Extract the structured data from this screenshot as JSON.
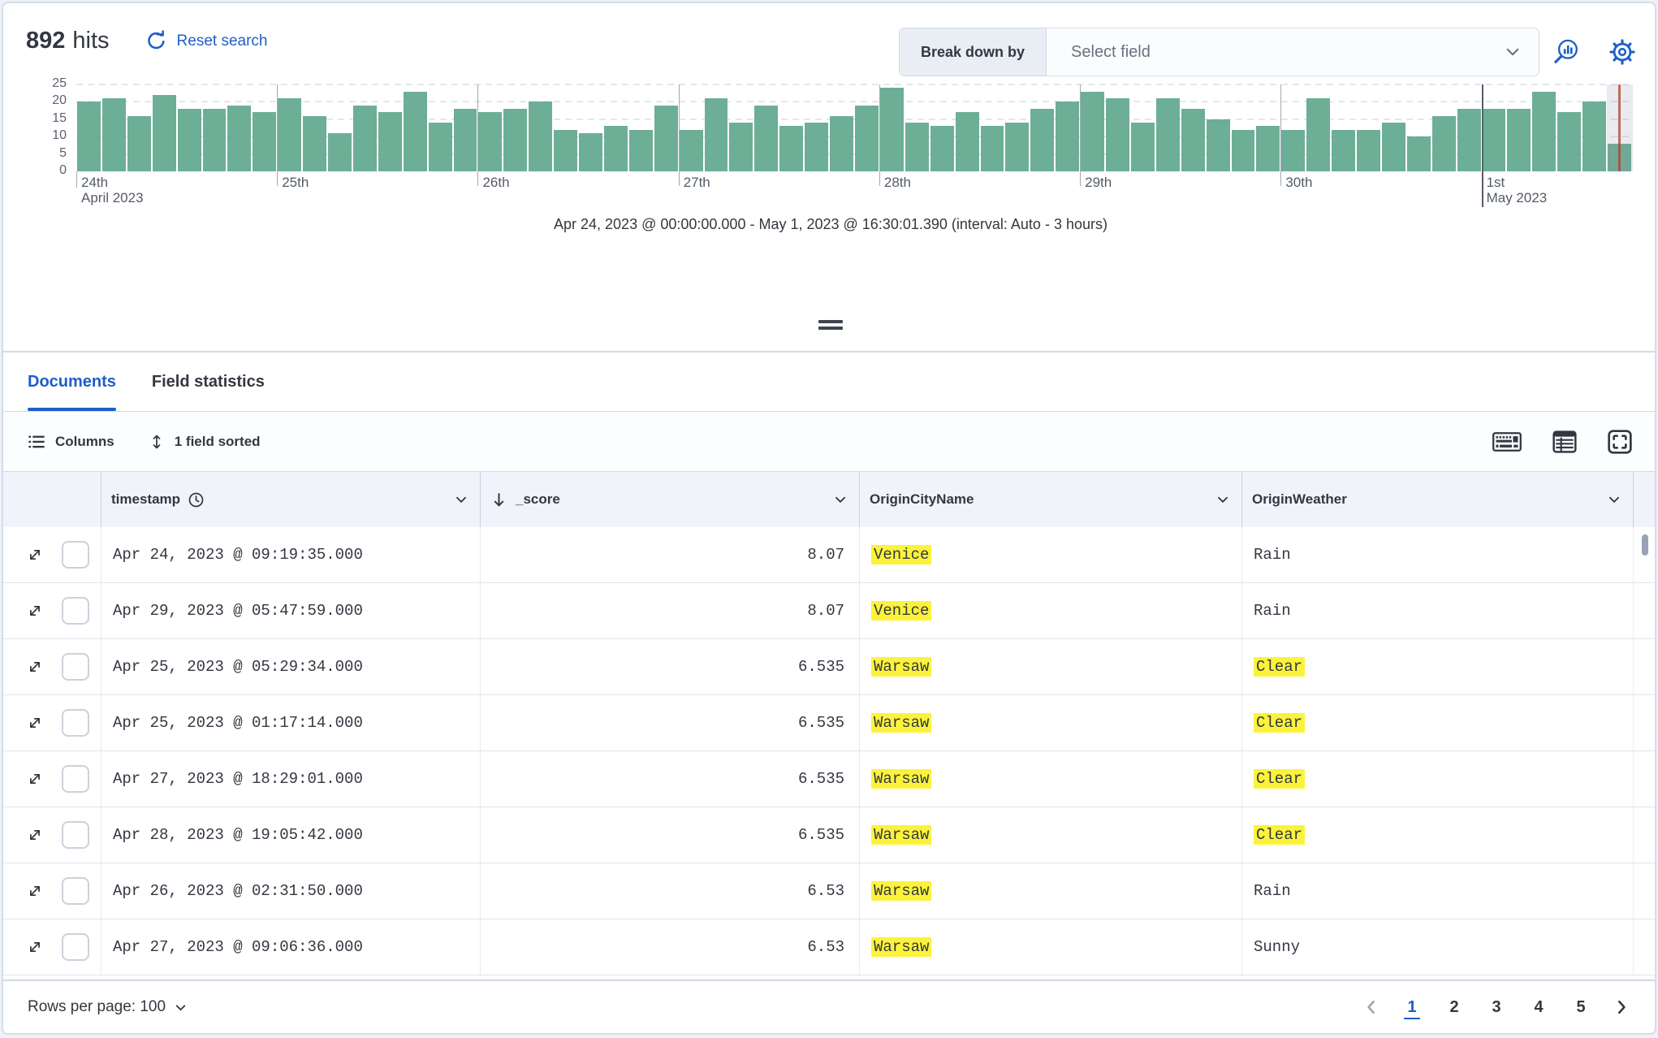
{
  "colors": {
    "accent": "#1E5EC8",
    "bar": "#6DAE96",
    "highlight": "#FBF33B",
    "marker_red": "#AE402A"
  },
  "header": {
    "hits_count": "892",
    "hits_label": "hits",
    "reset_label": "Reset search",
    "breakdown_label": "Break down by",
    "breakdown_placeholder": "Select field"
  },
  "chart_data": {
    "type": "bar",
    "title": "",
    "xlabel": "",
    "ylabel": "",
    "ylim": [
      0,
      25
    ],
    "y_ticks": [
      0,
      5,
      10,
      15,
      20,
      25
    ],
    "grid": "dashed-horizontal",
    "interval": "Auto - 3 hours",
    "x_start": "Apr 24, 2023 @ 00:00:00.000",
    "x_end": "May 1, 2023 @ 16:30:01.390",
    "bars_per_day": 8,
    "day_labels": [
      {
        "label": "24th",
        "sub": "April 2023"
      },
      {
        "label": "25th",
        "sub": ""
      },
      {
        "label": "26th",
        "sub": ""
      },
      {
        "label": "27th",
        "sub": ""
      },
      {
        "label": "28th",
        "sub": ""
      },
      {
        "label": "29th",
        "sub": ""
      },
      {
        "label": "30th",
        "sub": ""
      },
      {
        "label": "1st",
        "sub": "May 2023"
      }
    ],
    "values": [
      20,
      21,
      16,
      22,
      18,
      18,
      19,
      17,
      21,
      16,
      11,
      19,
      17,
      23,
      14,
      18,
      17,
      18,
      20,
      12,
      11,
      13,
      12,
      19,
      12,
      21,
      14,
      19,
      13,
      14,
      16,
      19,
      24,
      14,
      13,
      17,
      13,
      14,
      18,
      20,
      23,
      21,
      14,
      21,
      18,
      15,
      12,
      13,
      12,
      21,
      12,
      12,
      14,
      10,
      16,
      18,
      18,
      18,
      23,
      17,
      20,
      8
    ],
    "caption": "Apr 24, 2023 @ 00:00:00.000 - May 1, 2023 @ 16:30:01.390 (interval: Auto - 3 hours)"
  },
  "tabs": [
    {
      "label": "Documents",
      "active": true
    },
    {
      "label": "Field statistics",
      "active": false
    }
  ],
  "toolbar": {
    "columns_label": "Columns",
    "sorted_label": "1 field sorted"
  },
  "grid": {
    "columns": [
      {
        "label": "timestamp",
        "icon": "clock"
      },
      {
        "label": "_score",
        "icon": "sort-desc"
      },
      {
        "label": "OriginCityName",
        "icon": ""
      },
      {
        "label": "OriginWeather",
        "icon": ""
      }
    ],
    "rows": [
      {
        "timestamp": "Apr 24, 2023 @ 09:19:35.000",
        "score": "8.07",
        "city": "Venice",
        "city_highlighted": true,
        "weather": "Rain",
        "weather_highlighted": false
      },
      {
        "timestamp": "Apr 29, 2023 @ 05:47:59.000",
        "score": "8.07",
        "city": "Venice",
        "city_highlighted": true,
        "weather": "Rain",
        "weather_highlighted": false
      },
      {
        "timestamp": "Apr 25, 2023 @ 05:29:34.000",
        "score": "6.535",
        "city": "Warsaw",
        "city_highlighted": true,
        "weather": "Clear",
        "weather_highlighted": true
      },
      {
        "timestamp": "Apr 25, 2023 @ 01:17:14.000",
        "score": "6.535",
        "city": "Warsaw",
        "city_highlighted": true,
        "weather": "Clear",
        "weather_highlighted": true
      },
      {
        "timestamp": "Apr 27, 2023 @ 18:29:01.000",
        "score": "6.535",
        "city": "Warsaw",
        "city_highlighted": true,
        "weather": "Clear",
        "weather_highlighted": true
      },
      {
        "timestamp": "Apr 28, 2023 @ 19:05:42.000",
        "score": "6.535",
        "city": "Warsaw",
        "city_highlighted": true,
        "weather": "Clear",
        "weather_highlighted": true
      },
      {
        "timestamp": "Apr 26, 2023 @ 02:31:50.000",
        "score": "6.53",
        "city": "Warsaw",
        "city_highlighted": true,
        "weather": "Rain",
        "weather_highlighted": false
      },
      {
        "timestamp": "Apr 27, 2023 @ 09:06:36.000",
        "score": "6.53",
        "city": "Warsaw",
        "city_highlighted": true,
        "weather": "Sunny",
        "weather_highlighted": false
      }
    ]
  },
  "footer": {
    "rows_per_page_label": "Rows per page: 100",
    "pages": [
      "1",
      "2",
      "3",
      "4",
      "5"
    ],
    "active_page": "1"
  }
}
